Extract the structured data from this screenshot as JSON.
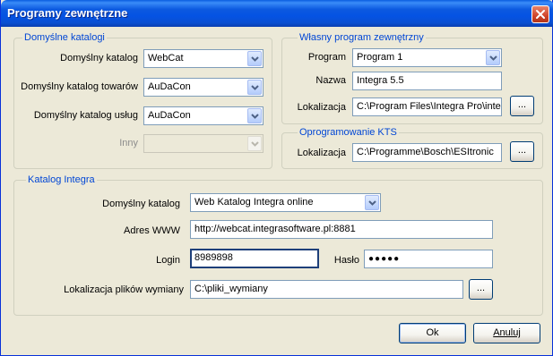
{
  "window": {
    "title": "Programy zewnętrzne"
  },
  "default_dirs": {
    "legend": "Domyślne katalogi",
    "default_dir_label": "Domyślny katalog",
    "default_dir_value": "WebCat",
    "goods_dir_label": "Domyślny katalog towarów",
    "goods_dir_value": "AuDaCon",
    "services_dir_label": "Domyślny katalog usług",
    "services_dir_value": "AuDaCon",
    "other_label": "Inny",
    "other_value": ""
  },
  "own_program": {
    "legend": "Własny program zewnętrzny",
    "program_label": "Program",
    "program_value": "Program 1",
    "name_label": "Nazwa",
    "name_value": "Integra 5.5",
    "location_label": "Lokalizacja",
    "location_value": "C:\\Program Files\\Integra Pro\\integ",
    "browse_label": "..."
  },
  "kts": {
    "legend": "Oprogramowanie KTS",
    "location_label": "Lokalizacja",
    "location_value": "C:\\Programme\\Bosch\\ESItronic",
    "browse_label": "..."
  },
  "integra_catalog": {
    "legend": "Katalog Integra",
    "default_dir_label": "Domyślny katalog",
    "default_dir_value": "Web Katalog Integra online",
    "www_label": "Adres WWW",
    "www_value": "http://webcat.integrasoftware.pl:8881",
    "login_label": "Login",
    "login_value": "8989898",
    "password_label": "Hasło",
    "password_value": "●●●●●",
    "exchange_label": "Lokalizacja plików wymiany",
    "exchange_value": "C:\\pliki_wymiany",
    "browse_label": "..."
  },
  "buttons": {
    "ok": "Ok",
    "cancel": "Anuluj"
  }
}
